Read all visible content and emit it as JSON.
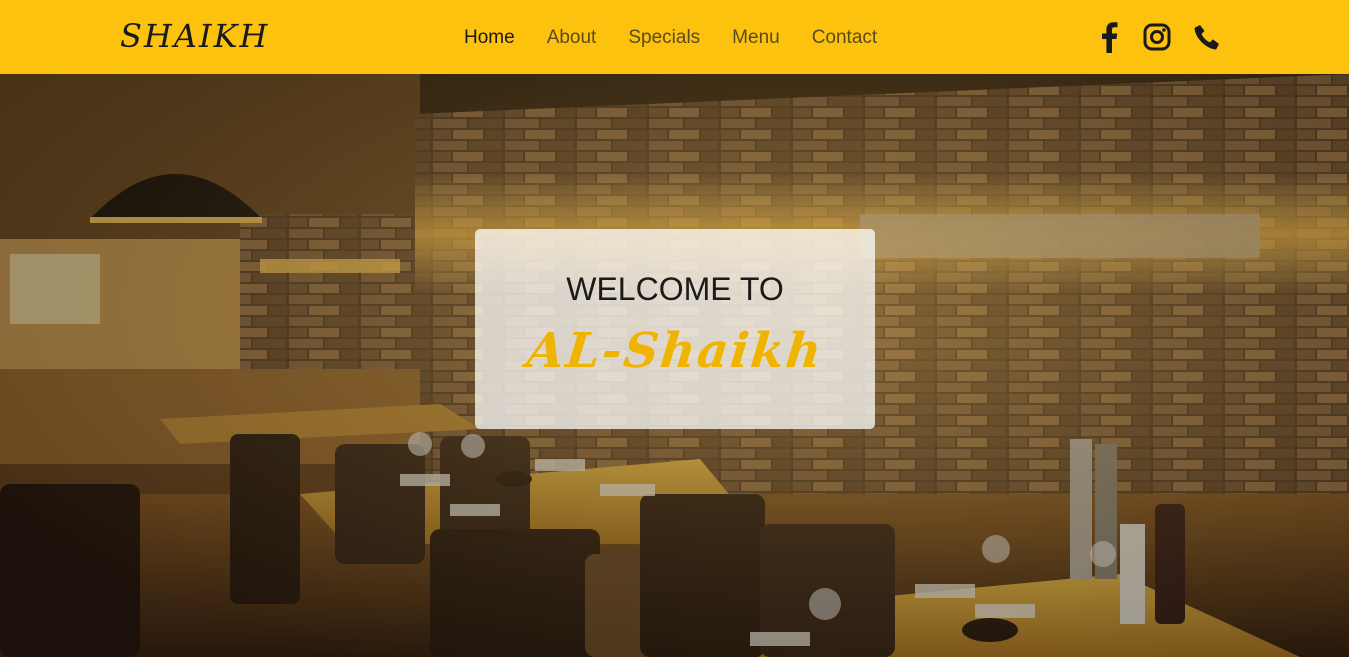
{
  "header": {
    "brand": "SHAIKH",
    "nav": [
      {
        "label": "Home",
        "active": true
      },
      {
        "label": "About"
      },
      {
        "label": "Specials"
      },
      {
        "label": "Menu"
      },
      {
        "label": "Contact"
      }
    ],
    "social": [
      "facebook-icon",
      "instagram-icon",
      "phone-icon"
    ]
  },
  "hero": {
    "welcome": "WELCOME TO",
    "name": "AL-Shaikh"
  },
  "colors": {
    "accent": "#fcc20e",
    "brand_text": "#f0b400",
    "text_dark": "#1a1a1a",
    "nav_muted": "#5a4a23"
  }
}
